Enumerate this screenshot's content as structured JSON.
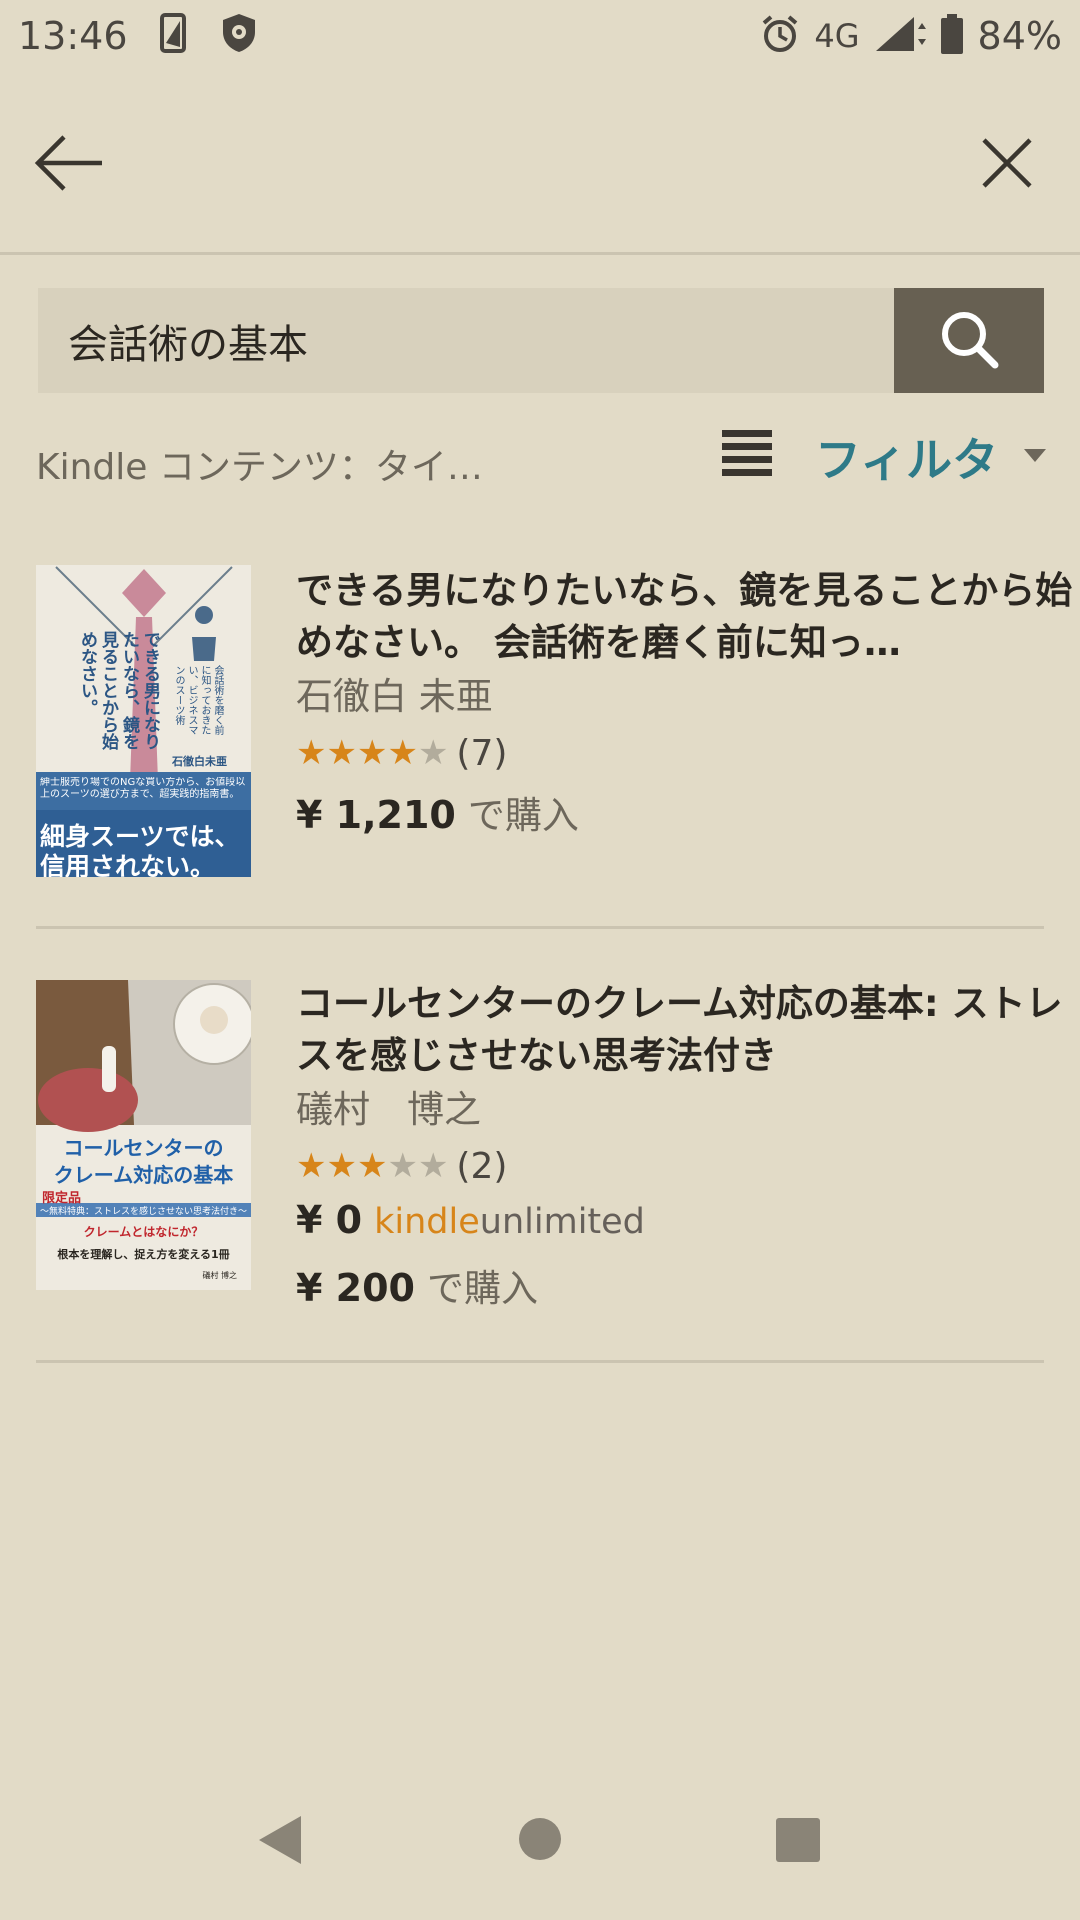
{
  "status_bar": {
    "time": "13:46",
    "network": "4G",
    "battery": "84%",
    "icons": [
      "phone-frame-icon",
      "shield-bug-icon",
      "alarm-icon",
      "signal-icon",
      "battery-icon"
    ]
  },
  "app_bar": {
    "back_icon": "arrow-left-icon",
    "close_icon": "close-icon"
  },
  "search": {
    "value": "会話術の基本",
    "button_icon": "search-icon"
  },
  "filters": {
    "scope": "Kindle コンテンツ：タイ…",
    "filter_label": "フィルタ",
    "list_view_icon": "list-view-icon",
    "dropdown_icon": "caret-down-icon"
  },
  "colors": {
    "accent": "#2e7a88",
    "star": "#d7851a",
    "search_button": "#676052",
    "background": "#e2dbc7"
  },
  "results": [
    {
      "title": "できる男になりたいなら、鏡を見ることから始めなさい。 会話術を磨く前に知っ…",
      "author": "石徹白 未亜",
      "rating": 4,
      "rating_count": "(7)",
      "prices": [
        {
          "amount": "¥ 1,210",
          "suffix": "で購入"
        }
      ],
      "cover": {
        "vertical_title": "できる男になりたいなら、鏡を見ることから始めなさい。",
        "vertical_sub": "会話術を磨く前に知っておきたい、ビジネスマンのスーツ術",
        "author_tag": "石徹白未亜",
        "blurb": "紳士服売り場でのNGな買い方から、お値段以上のスーツの選び方まで、超実践的指南書。",
        "band_line1": "細身スーツでは、",
        "band_line2": "信用されない。"
      }
    },
    {
      "title": "コールセンターのクレーム対応の基本: ストレスを感じさせない思考法付き",
      "author": "礒村　博之",
      "rating": 3,
      "rating_count": "(2)",
      "prices": [
        {
          "amount": "¥ 0",
          "logo_kindle": "kindle",
          "logo_unlimited": "unlimited"
        },
        {
          "amount": "¥ 200",
          "suffix": "で購入"
        }
      ],
      "cover": {
        "title_line1": "コールセンターの",
        "title_line2": "クレーム対応の基本",
        "badge": "限定品",
        "banner": "〜無料特典：ストレスを感じさせない思考法付き〜",
        "question": "クレームとはなにか？",
        "tagline": "根本を理解し、捉え方を変える1冊",
        "author_tag": "礒村 博之"
      }
    }
  ],
  "nav_bar": {
    "icons": [
      "back-triangle-icon",
      "home-circle-icon",
      "recents-square-icon"
    ]
  }
}
